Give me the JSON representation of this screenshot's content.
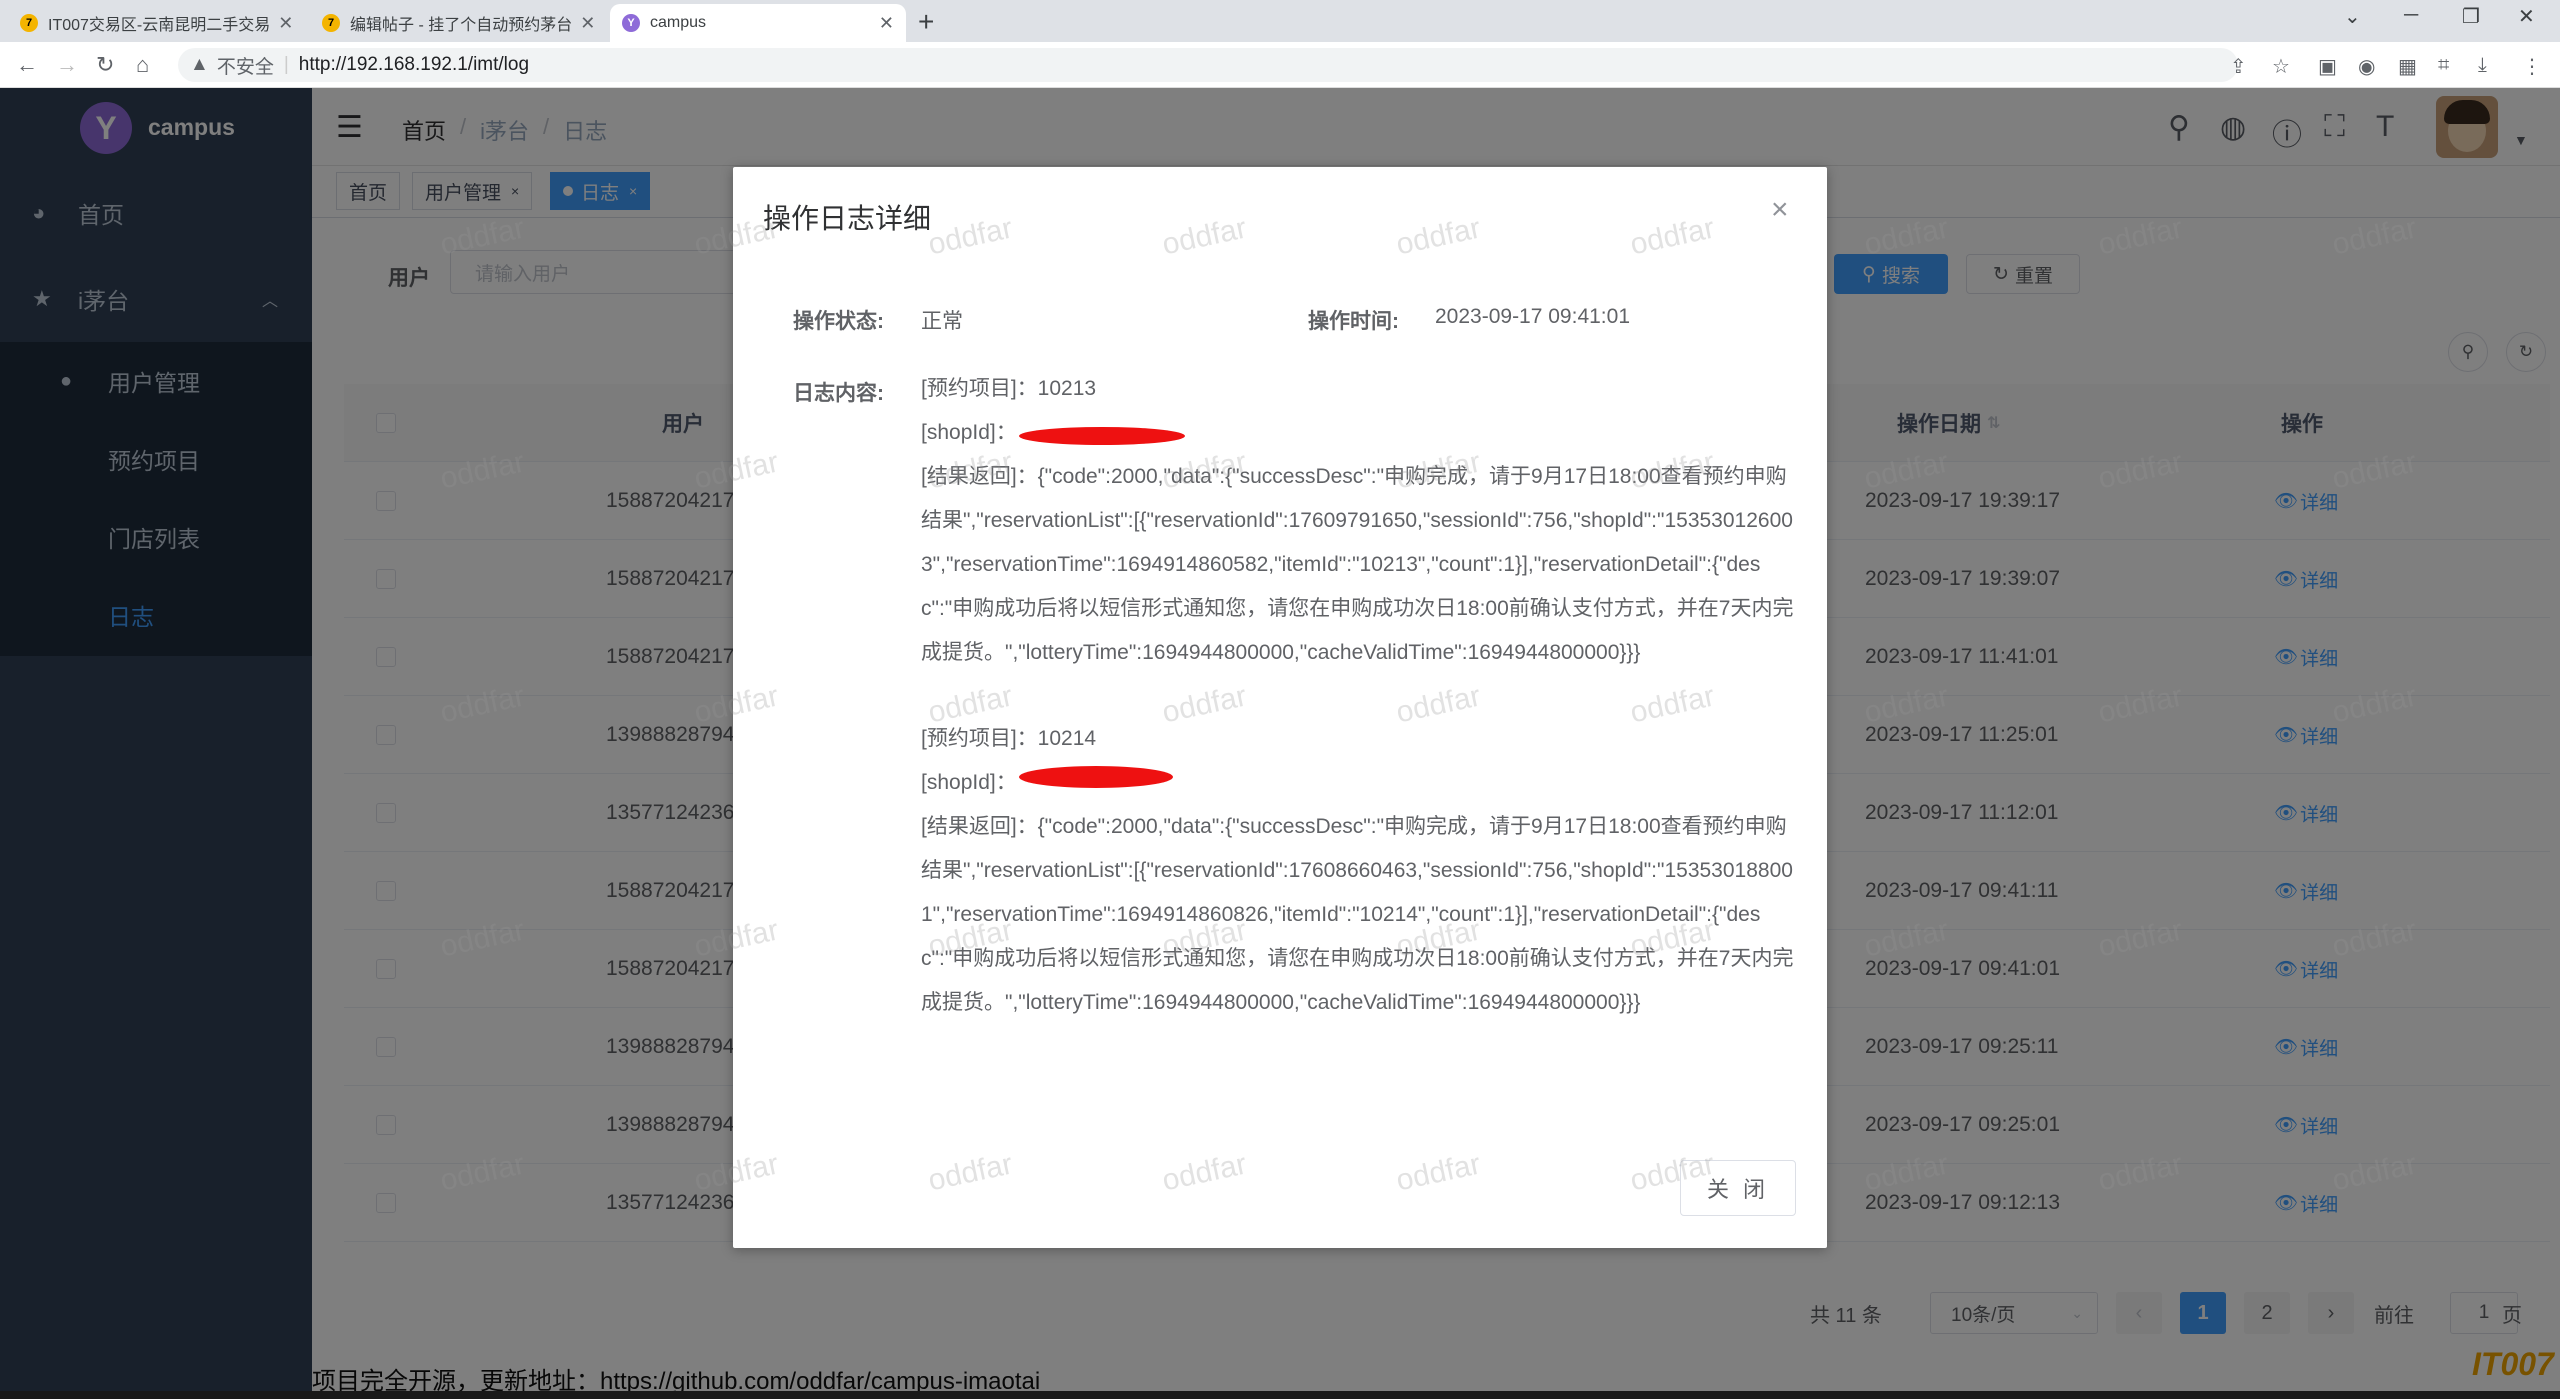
{
  "browser": {
    "tabs": [
      {
        "title": "IT007交易区-云南昆明二手交易",
        "icon": "tab-favicon"
      },
      {
        "title": "编辑帖子 - 挂了个自动预约茅台",
        "icon": "tab-favicon"
      },
      {
        "title": "campus",
        "icon": "campus-favicon"
      }
    ],
    "new_tab": "+",
    "security_label": "不安全",
    "url": "http://192.168.192.1/imt/log"
  },
  "app": {
    "name": "campus",
    "logo_glyph": "Y"
  },
  "sidebar": {
    "items": [
      {
        "label": "首页",
        "icon": "dashboard-icon"
      },
      {
        "label": "i茅台",
        "icon": "star-icon"
      }
    ],
    "sub_items": [
      {
        "label": "用户管理",
        "icon": "user-icon"
      },
      {
        "label": "预约项目"
      },
      {
        "label": "门店列表"
      },
      {
        "label": "日志",
        "active": true
      }
    ]
  },
  "header": {
    "breadcrumb": [
      "首页",
      "i茅台",
      "日志"
    ],
    "breadcrumb_sep": "/"
  },
  "tags": [
    {
      "label": "首页"
    },
    {
      "label": "用户管理",
      "close": "×"
    },
    {
      "label": "日志",
      "close": "×",
      "active": true
    }
  ],
  "search": {
    "label": "用户",
    "placeholder": "请输入用户",
    "search_button": "搜索",
    "reset_button": "重置"
  },
  "table": {
    "columns": [
      "用户",
      "操作日期",
      "操作"
    ],
    "rows": [
      {
        "user": "15887204217",
        "date": "2023-09-17 19:39:17",
        "action": "详细"
      },
      {
        "user": "15887204217",
        "date": "2023-09-17 19:39:07",
        "action": "详细"
      },
      {
        "user": "15887204217",
        "date": "2023-09-17 11:41:01",
        "action": "详细"
      },
      {
        "user": "13988828794",
        "date": "2023-09-17 11:25:01",
        "action": "详细"
      },
      {
        "user": "13577124236",
        "date": "2023-09-17 11:12:01",
        "action": "详细"
      },
      {
        "user": "15887204217",
        "date": "2023-09-17 09:41:11",
        "action": "详细"
      },
      {
        "user": "15887204217",
        "date": "2023-09-17 09:41:01",
        "action": "详细"
      },
      {
        "user": "13988828794",
        "date": "2023-09-17 09:25:11",
        "action": "详细"
      },
      {
        "user": "13988828794",
        "date": "2023-09-17 09:25:01",
        "action": "详细"
      },
      {
        "user": "13577124236",
        "date": "2023-09-17 09:12:13",
        "action": "详细"
      }
    ]
  },
  "pagination": {
    "total": "共 11 条",
    "page_size": "10条/页",
    "pages": [
      "1",
      "2"
    ],
    "current": "1",
    "goto_label": "前往",
    "goto_value": "1",
    "page_suffix": "页",
    "prev": "‹",
    "next": "›"
  },
  "footer": {
    "text": "项目完全开源，更新地址：https://github.com/oddfar/campus-imaotai"
  },
  "corner_logo": "IT007",
  "dialog": {
    "title": "操作日志详细",
    "status_label": "操作状态:",
    "status_value": "正常",
    "time_label": "操作时间:",
    "time_value": "2023-09-17 09:41:01",
    "content_label": "日志内容:",
    "logs": [
      {
        "item": "[预约项目]：10213",
        "shop": "[shopId]：",
        "result": "[结果返回]：{\"code\":2000,\"data\":{\"successDesc\":\"申购完成，请于9月17日18:00查看预约申购结果\",\"reservationList\":[{\"reservationId\":17609791650,\"sessionId\":756,\"shopId\":\"153530126003\",\"reservationTime\":1694914860582,\"itemId\":\"10213\",\"count\":1}],\"reservationDetail\":{\"desc\":\"申购成功后将以短信形式通知您，请您在申购成功次日18:00前确认支付方式，并在7天内完成提货。\",\"lotteryTime\":1694944800000,\"cacheValidTime\":1694944800000}}}"
      },
      {
        "item": "[预约项目]：10214",
        "shop": "[shopId]：",
        "result": "[结果返回]：{\"code\":2000,\"data\":{\"successDesc\":\"申购完成，请于9月17日18:00查看预约申购结果\",\"reservationList\":[{\"reservationId\":17608660463,\"sessionId\":756,\"shopId\":\"153530188001\",\"reservationTime\":1694914860826,\"itemId\":\"10214\",\"count\":1}],\"reservationDetail\":{\"desc\":\"申购成功后将以短信形式通知您，请您在申购成功次日18:00前确认支付方式，并在7天内完成提货。\",\"lotteryTime\":1694944800000,\"cacheValidTime\":1694944800000}}}"
      }
    ],
    "close_button": "关 闭",
    "close_x": "×"
  },
  "watermark": "oddfar",
  "colors": {
    "sidebar_bg": "#304156",
    "submenu_bg": "#1f2d3d",
    "accent": "#409eff",
    "redaction": "#ee1111"
  }
}
